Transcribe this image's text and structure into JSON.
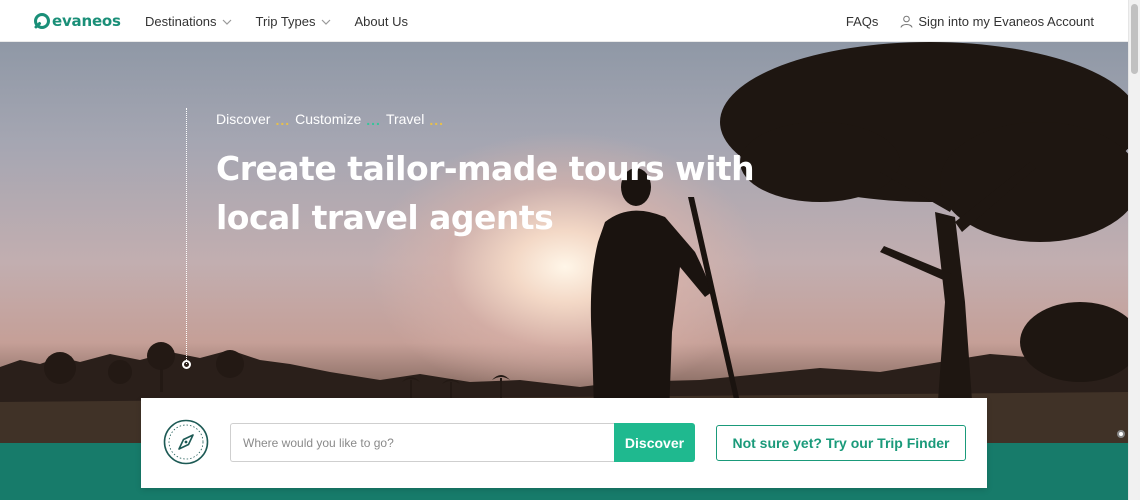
{
  "brand": {
    "name": "evaneos",
    "color": "#1a8f78"
  },
  "nav": {
    "items": [
      {
        "label": "Destinations",
        "has_dropdown": true
      },
      {
        "label": "Trip Types",
        "has_dropdown": true
      },
      {
        "label": "About Us",
        "has_dropdown": false
      }
    ],
    "faq_label": "FAQs",
    "signin_label": "Sign into my Evaneos Account"
  },
  "hero": {
    "steps": [
      "Discover",
      "Customize",
      "Travel"
    ],
    "title": "Create tailor-made tours with local travel agents"
  },
  "search": {
    "placeholder": "Where would you like to go?",
    "value": "",
    "button_label": "Discover",
    "finder_label": "Not sure yet? Try our Trip Finder"
  },
  "colors": {
    "accent": "#1fb98f",
    "band": "#177b6a",
    "dots_yellow": "#e8c04a",
    "dots_green": "#37c49a"
  },
  "icons": {
    "logo": "evaneos-logo-icon",
    "user": "user-icon",
    "chevron": "chevron-down-icon",
    "compass": "compass-icon"
  }
}
